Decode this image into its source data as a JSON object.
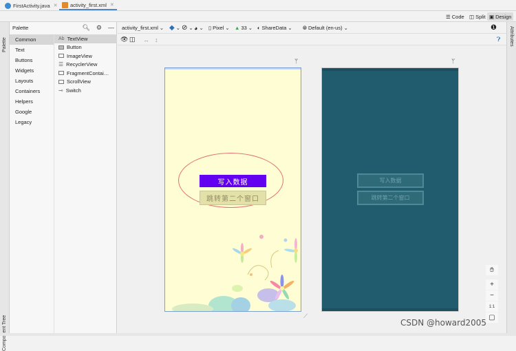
{
  "tabs": [
    {
      "label": "FirstActivity.java",
      "color": "#3d8bd1"
    },
    {
      "label": "activity_first.xml",
      "color": "#e08a2c"
    }
  ],
  "modes": {
    "code": "Code",
    "split": "Split",
    "design": "Design"
  },
  "left_strip": {
    "palette_label": "Palette",
    "component_tree_label": "Component Tree"
  },
  "right_strip": {
    "attributes_label": "Attributes"
  },
  "palette": {
    "title": "Palette",
    "categories": [
      "Common",
      "Text",
      "Buttons",
      "Widgets",
      "Layouts",
      "Containers",
      "Helpers",
      "Google",
      "Legacy"
    ],
    "selected_category": "Common",
    "widgets": [
      "TextView",
      "Button",
      "ImageView",
      "RecyclerView",
      "FragmentContai…",
      "ScrollView",
      "Switch"
    ],
    "selected_widget": "TextView"
  },
  "design_toolbar": {
    "file": "activity_first.xml",
    "device": "Pixel",
    "api": "33",
    "theme": "ShareData",
    "locale": "Default (en-us)"
  },
  "preview": {
    "button_write": "写入数据",
    "button_jump": "跳转第二个窗口",
    "accent_button": "#6300f0",
    "phone_background": "#fefdd4",
    "blueprint_background": "#215b6e"
  },
  "zoom_controls": {
    "plus": "+",
    "minus": "−",
    "one_to_one": "1:1"
  },
  "watermark": "CSDN @howard2005"
}
